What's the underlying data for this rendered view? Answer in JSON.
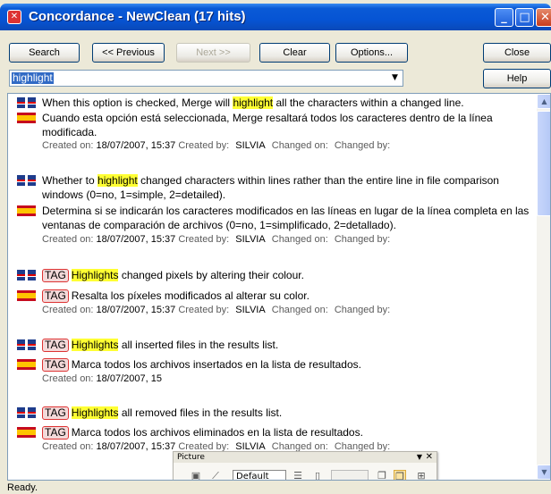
{
  "window": {
    "title": "Concordance - NewClean (17 hits)",
    "icon": "concordance-app-icon",
    "controls": [
      "minimize",
      "maximize",
      "close"
    ]
  },
  "toolbar": {
    "search": "Search",
    "previous": "<< Previous",
    "next": "Next >>",
    "clear": "Clear",
    "options": "Options...",
    "close": "Close",
    "help": "Help"
  },
  "search": {
    "value": "highlight"
  },
  "entries": [
    {
      "source": [
        "When this option is checked, Merge will ",
        "highlight",
        " all the characters within a changed line."
      ],
      "target": "Cuando esta opción está seleccionada, Merge resaltará todos los caracteres dentro de la línea modificada.",
      "created_on": "18/07/2007, 15:37",
      "created_by": "SILVIA"
    },
    {
      "source": [
        "Whether to ",
        "highlight",
        " changed characters within lines rather than the entire line in file comparison windows (0=no, 1=simple, 2=detailed)."
      ],
      "target": "Determina si se indicarán los caracteres modificados en las líneas en lugar de la línea completa en las ventanas de comparación de archivos (0=no, 1=simplificado, 2=detallado).",
      "created_on": "18/07/2007, 15:37",
      "created_by": "SILVIA"
    },
    {
      "tag": "TAG",
      "source": [
        "",
        "Highlights",
        " changed pixels by altering their colour."
      ],
      "target": "Resalta los píxeles modificados al alterar su color.",
      "created_on": "18/07/2007, 15:37",
      "created_by": "SILVIA"
    },
    {
      "tag": "TAG",
      "source": [
        "",
        "Highlights",
        " all inserted files in the results list."
      ],
      "target": "Marca todos los archivos insertados en la lista de resultados.",
      "created_on": "18/07/2007, 15",
      "created_by": ""
    },
    {
      "tag": "TAG",
      "source": [
        "",
        "Highlights",
        " all removed files in the results list."
      ],
      "target": "Marca todos los archivos eliminados en la lista de resultados.",
      "created_on": "18/07/2007, 15:37",
      "created_by": "SILVIA"
    }
  ],
  "labels": {
    "created_on": "Created on:",
    "created_by": "Created by:",
    "changed_on": "Changed on:",
    "changed_by": "Changed by:"
  },
  "picture_toolbar": {
    "title": "Picture",
    "mode": "Default"
  },
  "status": "Ready."
}
